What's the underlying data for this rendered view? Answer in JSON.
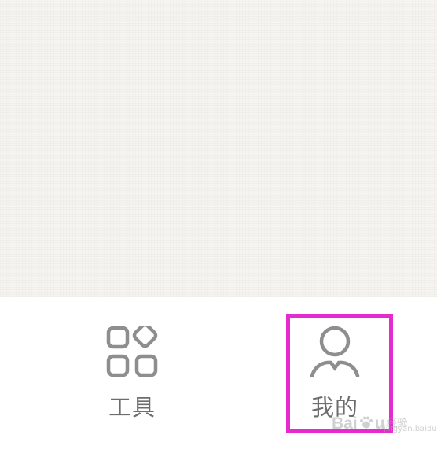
{
  "tab_bar": {
    "tabs": [
      {
        "id": "tools",
        "label": "工具",
        "icon": "grid-apps-icon",
        "selected": false
      },
      {
        "id": "mine",
        "label": "我的",
        "icon": "user-profile-icon",
        "selected": true
      }
    ]
  },
  "annotation": {
    "highlight_color": "#e52bcf",
    "highlighted_tab": "mine"
  },
  "watermark": {
    "brand_left": "Bai",
    "brand_right": "u",
    "brand_suffix": "经验",
    "url": "jingyan.baidu.com"
  },
  "colors": {
    "content_background": "#f6f4f0",
    "tab_bar_background": "#ffffff",
    "tab_label": "#6d6d6d",
    "icon_stroke": "#8e8e8e"
  }
}
